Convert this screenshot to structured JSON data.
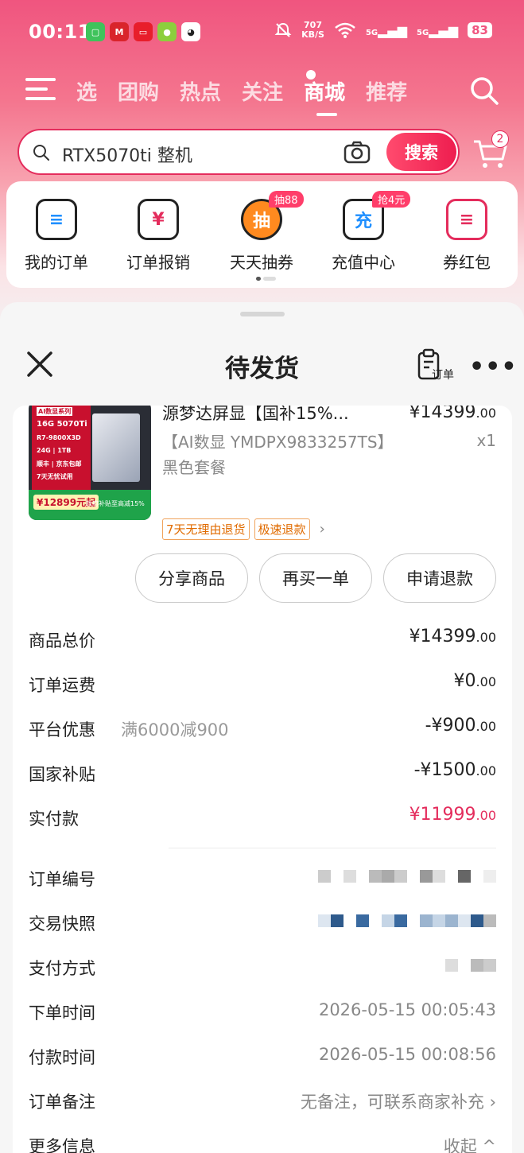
{
  "status_bar": {
    "time": "00:11",
    "net_speed_value": "707",
    "net_speed_unit": "KB/S",
    "signal_1": "5G",
    "signal_2": "5G",
    "battery": "83"
  },
  "nav": {
    "tabs": [
      "选",
      "团购",
      "热点",
      "关注",
      "商城",
      "推荐"
    ],
    "active_tab": "商城"
  },
  "search": {
    "query": "RTX5070ti 整机",
    "button_label": "搜索",
    "cart_badge": "2"
  },
  "shortcuts": [
    {
      "label": "我的订单",
      "glyph": "≡"
    },
    {
      "label": "订单报销",
      "glyph": "¥"
    },
    {
      "label": "天天抽券",
      "glyph": "抽",
      "badge": "抽88"
    },
    {
      "label": "充值中心",
      "glyph": "充",
      "badge": "抢4元"
    },
    {
      "label": "券红包",
      "glyph": "≡"
    }
  ],
  "sheet": {
    "title": "待发货",
    "order_icon_label": "订单",
    "more": "•••"
  },
  "product": {
    "title": "源梦达屏显【国补15%...",
    "spec": "【AI数显 YMDPX9833257TS】黑色套餐",
    "price_main": "¥14399",
    "price_decimal": ".00",
    "qty": "x1",
    "tags": [
      "7天无理由退货",
      "极速退款"
    ],
    "image_text": {
      "badge": "AI数显系列",
      "gpu": "16G 5070Ti",
      "cpu": "R7-9800X3D",
      "mem": "24G | 1TB",
      "ship": "顺丰 | 京东包邮",
      "trial": "7天无忧试用",
      "price": "¥12899元起",
      "promo": "政府补贴至高减15%"
    }
  },
  "actions": {
    "share": "分享商品",
    "rebuy": "再买一单",
    "refund": "申请退款"
  },
  "price_rows": [
    {
      "label": "商品总价",
      "note": "",
      "value": "¥14399",
      "decimal": ".00",
      "red": false
    },
    {
      "label": "订单运费",
      "note": "",
      "value": "¥0",
      "decimal": ".00",
      "red": false
    },
    {
      "label": "平台优惠",
      "note": "满6000减900",
      "value": "-¥900",
      "decimal": ".00",
      "red": false
    },
    {
      "label": "国家补贴",
      "note": "",
      "value": "-¥1500",
      "decimal": ".00",
      "red": false
    },
    {
      "label": "实付款",
      "note": "",
      "value": "¥11999",
      "decimal": ".00",
      "red": true
    }
  ],
  "info_rows": {
    "order_no_label": "订单编号",
    "snapshot_label": "交易快照",
    "pay_method_label": "支付方式",
    "order_time_label": "下单时间",
    "order_time": "2026-05-15 00:05:43",
    "pay_time_label": "付款时间",
    "pay_time": "2026-05-15 00:08:56",
    "remark_label": "订单备注",
    "remark": "无备注，可联系商家补充 ›",
    "more_label": "更多信息",
    "more_value": "收起 ^"
  },
  "colors": {
    "brand": "#e42c5c",
    "tag": "#e06b00"
  }
}
